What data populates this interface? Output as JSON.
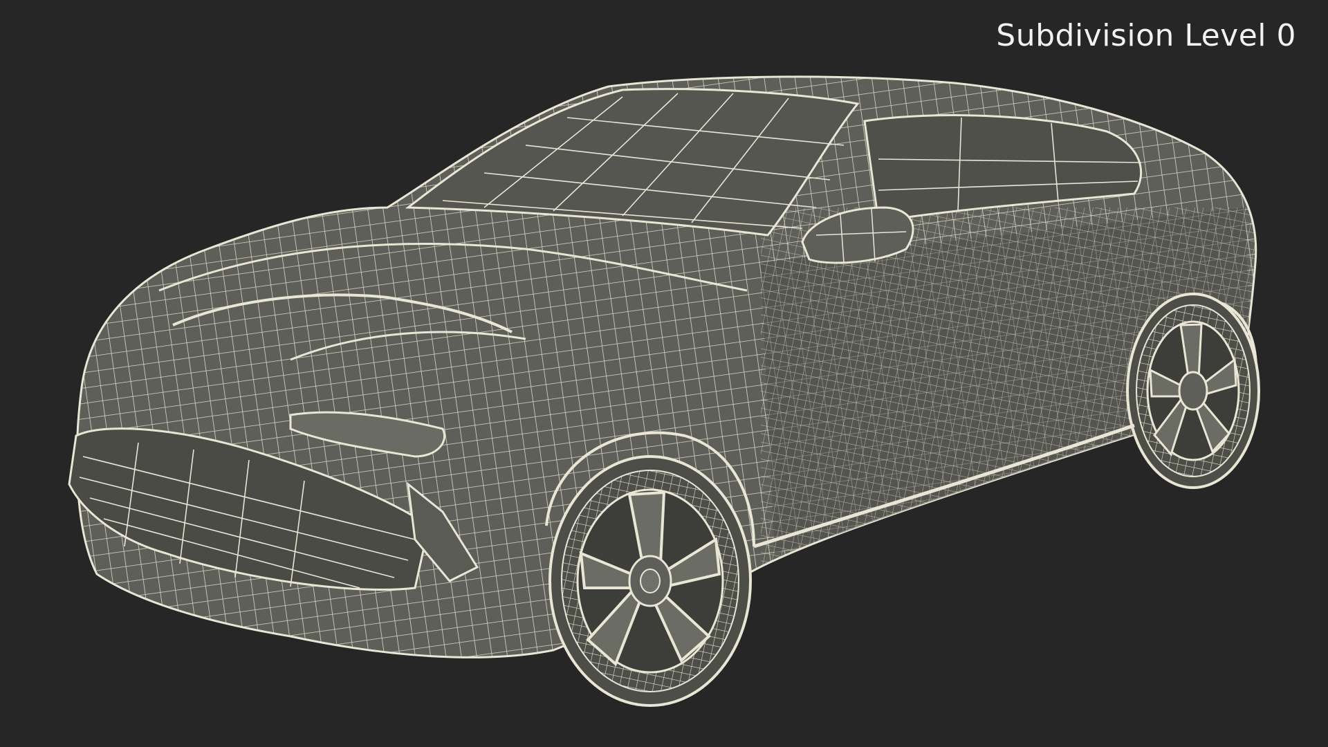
{
  "overlay": {
    "label": "Subdivision Level 0"
  },
  "subject": {
    "icon": "car-wireframe-icon"
  },
  "colors": {
    "background": "#262626",
    "body_fill": "#5e5f58",
    "body_shade": "#4c4d47",
    "wire": "#e9e6d6",
    "label": "#f2f2f2"
  }
}
